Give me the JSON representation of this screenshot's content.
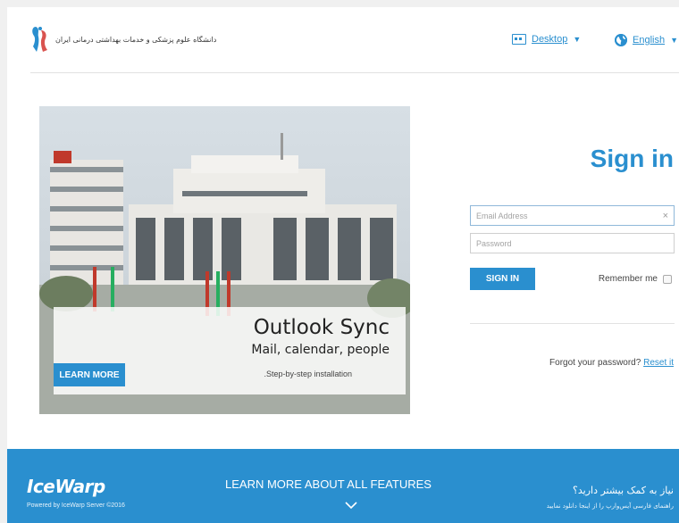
{
  "header": {
    "logo_text": "دانشگاه علوم پزشکی و خدمات بهداشتی درمانی ایران",
    "desktop_label": "Desktop",
    "language_label": "English"
  },
  "promo": {
    "title": "Outlook Sync",
    "subtitle": "Mail, calendar, people",
    "step_text": ".Step-by-step installation",
    "learn_more_label": "LEARN MORE"
  },
  "signin": {
    "title": "Sign in",
    "email_placeholder": "Email Address",
    "email_value": "",
    "password_placeholder": "Password",
    "password_value": "",
    "clear_symbol": "×",
    "submit_label": "SIGN IN",
    "remember_label": "Remember me",
    "forgot_label": "Forgot your password?",
    "reset_label": "Reset it"
  },
  "footer": {
    "brand": "IceWarp",
    "powered": "Powered by IceWarp Server ©2016",
    "features_label": "LEARN MORE ABOUT ALL FEATURES",
    "help_title": "نیاز به کمک بیشتر دارید؟",
    "help_sub": "راهنمای فارسی آیس‌وارپ را از اینجا دانلود نمایید"
  },
  "colors": {
    "accent": "#2a8fcf",
    "footer_bg": "#2a8fcf"
  },
  "icons": {
    "desktop": "desktop-icon",
    "language": "globe-icon",
    "clear": "close-icon",
    "features": "chevron-down-icon"
  }
}
